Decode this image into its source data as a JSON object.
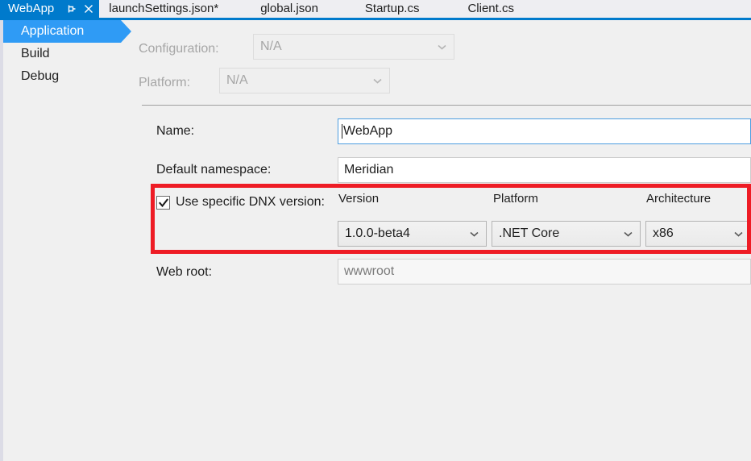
{
  "window": {
    "accent_color": "#007acc",
    "selection_color": "#2f9bf5",
    "annotation_color": "#ee1c25",
    "background": "#f0f0f0"
  },
  "tabs": {
    "items": [
      {
        "label": "WebApp",
        "active": true,
        "modified": false
      },
      {
        "label": "launchSettings.json*",
        "active": false,
        "modified": true
      },
      {
        "label": "global.json",
        "active": false,
        "modified": false
      },
      {
        "label": "Startup.cs",
        "active": false,
        "modified": false
      },
      {
        "label": "Client.cs",
        "active": false,
        "modified": false
      }
    ],
    "pin_icon": "pin-icon",
    "close_icon": "close-icon"
  },
  "sidebar": {
    "items": [
      {
        "label": "Application",
        "selected": true
      },
      {
        "label": "Build",
        "selected": false
      },
      {
        "label": "Debug",
        "selected": false
      }
    ]
  },
  "main": {
    "configuration": {
      "label": "Configuration:",
      "value": "N/A",
      "disabled": true
    },
    "platform_top": {
      "label": "Platform:",
      "value": "N/A",
      "disabled": true
    },
    "name": {
      "label": "Name:",
      "value": "WebApp",
      "focused": true
    },
    "default_namespace": {
      "label": "Default namespace:",
      "value": "Meridian",
      "focused": false
    },
    "dnx": {
      "checkbox_label": "Use specific DNX version:",
      "checked": true,
      "version": {
        "column_header": "Version",
        "value": "1.0.0-beta4"
      },
      "platform": {
        "column_header": "Platform",
        "value": ".NET Core"
      },
      "architecture": {
        "column_header": "Architecture",
        "value": "x86"
      }
    },
    "web_root": {
      "label": "Web root:",
      "value": "wwwroot",
      "readonly": true
    }
  }
}
